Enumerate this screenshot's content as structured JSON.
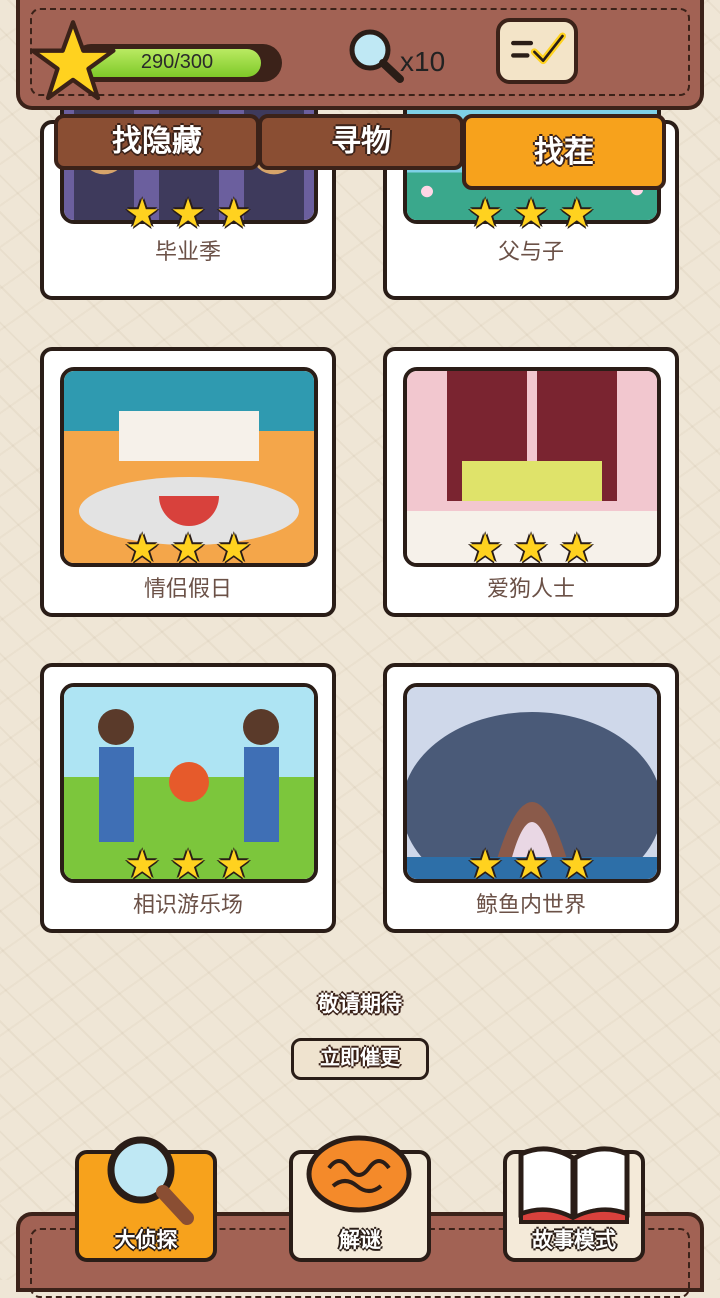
{
  "header": {
    "progress_text": "290/300",
    "progress_value": 0.967,
    "magnifier_count": "x10",
    "task_icon": "checklist-icon"
  },
  "tabs": [
    {
      "label": "找隐藏",
      "active": false
    },
    {
      "label": "寻物",
      "active": false
    },
    {
      "label": "找茬",
      "active": true
    }
  ],
  "levels": [
    {
      "title": "毕业季",
      "stars": "★★★"
    },
    {
      "title": "父与子",
      "stars": "★★★"
    },
    {
      "title": "情侣假日",
      "stars": "★★★"
    },
    {
      "title": "爱狗人士",
      "stars": "★★★"
    },
    {
      "title": "相识游乐场",
      "stars": "★★★"
    },
    {
      "title": "鲸鱼内世界",
      "stars": "★★★"
    }
  ],
  "footer_notice": {
    "coming_soon": "敬请期待",
    "urge_button": "立即催更"
  },
  "bottom_nav": [
    {
      "label": "大侦探",
      "icon": "magnifier-icon",
      "active": true
    },
    {
      "label": "解谜",
      "icon": "brain-icon",
      "active": false
    },
    {
      "label": "故事模式",
      "icon": "book-icon",
      "active": false
    }
  ],
  "colors": {
    "accent": "#f7a21c",
    "header_brown": "#a26254",
    "star_yellow": "#ffd21f",
    "progress_green": "#7fc928"
  }
}
